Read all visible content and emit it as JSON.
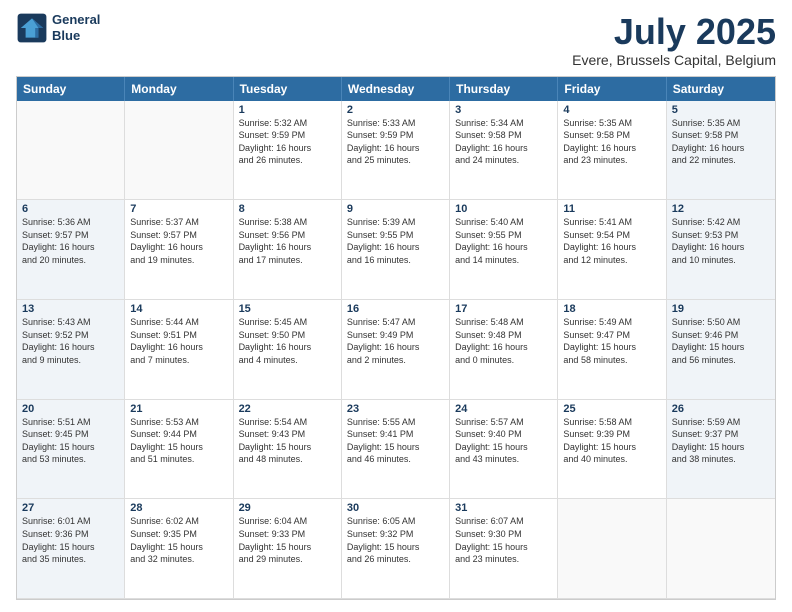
{
  "logo": {
    "line1": "General",
    "line2": "Blue"
  },
  "title": "July 2025",
  "location": "Evere, Brussels Capital, Belgium",
  "dayHeaders": [
    "Sunday",
    "Monday",
    "Tuesday",
    "Wednesday",
    "Thursday",
    "Friday",
    "Saturday"
  ],
  "weeks": [
    [
      {
        "day": "",
        "empty": true,
        "weekend": false,
        "lines": []
      },
      {
        "day": "",
        "empty": true,
        "weekend": false,
        "lines": []
      },
      {
        "day": "1",
        "empty": false,
        "weekend": false,
        "lines": [
          "Sunrise: 5:32 AM",
          "Sunset: 9:59 PM",
          "Daylight: 16 hours",
          "and 26 minutes."
        ]
      },
      {
        "day": "2",
        "empty": false,
        "weekend": false,
        "lines": [
          "Sunrise: 5:33 AM",
          "Sunset: 9:59 PM",
          "Daylight: 16 hours",
          "and 25 minutes."
        ]
      },
      {
        "day": "3",
        "empty": false,
        "weekend": false,
        "lines": [
          "Sunrise: 5:34 AM",
          "Sunset: 9:58 PM",
          "Daylight: 16 hours",
          "and 24 minutes."
        ]
      },
      {
        "day": "4",
        "empty": false,
        "weekend": false,
        "lines": [
          "Sunrise: 5:35 AM",
          "Sunset: 9:58 PM",
          "Daylight: 16 hours",
          "and 23 minutes."
        ]
      },
      {
        "day": "5",
        "empty": false,
        "weekend": true,
        "lines": [
          "Sunrise: 5:35 AM",
          "Sunset: 9:58 PM",
          "Daylight: 16 hours",
          "and 22 minutes."
        ]
      }
    ],
    [
      {
        "day": "6",
        "empty": false,
        "weekend": true,
        "lines": [
          "Sunrise: 5:36 AM",
          "Sunset: 9:57 PM",
          "Daylight: 16 hours",
          "and 20 minutes."
        ]
      },
      {
        "day": "7",
        "empty": false,
        "weekend": false,
        "lines": [
          "Sunrise: 5:37 AM",
          "Sunset: 9:57 PM",
          "Daylight: 16 hours",
          "and 19 minutes."
        ]
      },
      {
        "day": "8",
        "empty": false,
        "weekend": false,
        "lines": [
          "Sunrise: 5:38 AM",
          "Sunset: 9:56 PM",
          "Daylight: 16 hours",
          "and 17 minutes."
        ]
      },
      {
        "day": "9",
        "empty": false,
        "weekend": false,
        "lines": [
          "Sunrise: 5:39 AM",
          "Sunset: 9:55 PM",
          "Daylight: 16 hours",
          "and 16 minutes."
        ]
      },
      {
        "day": "10",
        "empty": false,
        "weekend": false,
        "lines": [
          "Sunrise: 5:40 AM",
          "Sunset: 9:55 PM",
          "Daylight: 16 hours",
          "and 14 minutes."
        ]
      },
      {
        "day": "11",
        "empty": false,
        "weekend": false,
        "lines": [
          "Sunrise: 5:41 AM",
          "Sunset: 9:54 PM",
          "Daylight: 16 hours",
          "and 12 minutes."
        ]
      },
      {
        "day": "12",
        "empty": false,
        "weekend": true,
        "lines": [
          "Sunrise: 5:42 AM",
          "Sunset: 9:53 PM",
          "Daylight: 16 hours",
          "and 10 minutes."
        ]
      }
    ],
    [
      {
        "day": "13",
        "empty": false,
        "weekend": true,
        "lines": [
          "Sunrise: 5:43 AM",
          "Sunset: 9:52 PM",
          "Daylight: 16 hours",
          "and 9 minutes."
        ]
      },
      {
        "day": "14",
        "empty": false,
        "weekend": false,
        "lines": [
          "Sunrise: 5:44 AM",
          "Sunset: 9:51 PM",
          "Daylight: 16 hours",
          "and 7 minutes."
        ]
      },
      {
        "day": "15",
        "empty": false,
        "weekend": false,
        "lines": [
          "Sunrise: 5:45 AM",
          "Sunset: 9:50 PM",
          "Daylight: 16 hours",
          "and 4 minutes."
        ]
      },
      {
        "day": "16",
        "empty": false,
        "weekend": false,
        "lines": [
          "Sunrise: 5:47 AM",
          "Sunset: 9:49 PM",
          "Daylight: 16 hours",
          "and 2 minutes."
        ]
      },
      {
        "day": "17",
        "empty": false,
        "weekend": false,
        "lines": [
          "Sunrise: 5:48 AM",
          "Sunset: 9:48 PM",
          "Daylight: 16 hours",
          "and 0 minutes."
        ]
      },
      {
        "day": "18",
        "empty": false,
        "weekend": false,
        "lines": [
          "Sunrise: 5:49 AM",
          "Sunset: 9:47 PM",
          "Daylight: 15 hours",
          "and 58 minutes."
        ]
      },
      {
        "day": "19",
        "empty": false,
        "weekend": true,
        "lines": [
          "Sunrise: 5:50 AM",
          "Sunset: 9:46 PM",
          "Daylight: 15 hours",
          "and 56 minutes."
        ]
      }
    ],
    [
      {
        "day": "20",
        "empty": false,
        "weekend": true,
        "lines": [
          "Sunrise: 5:51 AM",
          "Sunset: 9:45 PM",
          "Daylight: 15 hours",
          "and 53 minutes."
        ]
      },
      {
        "day": "21",
        "empty": false,
        "weekend": false,
        "lines": [
          "Sunrise: 5:53 AM",
          "Sunset: 9:44 PM",
          "Daylight: 15 hours",
          "and 51 minutes."
        ]
      },
      {
        "day": "22",
        "empty": false,
        "weekend": false,
        "lines": [
          "Sunrise: 5:54 AM",
          "Sunset: 9:43 PM",
          "Daylight: 15 hours",
          "and 48 minutes."
        ]
      },
      {
        "day": "23",
        "empty": false,
        "weekend": false,
        "lines": [
          "Sunrise: 5:55 AM",
          "Sunset: 9:41 PM",
          "Daylight: 15 hours",
          "and 46 minutes."
        ]
      },
      {
        "day": "24",
        "empty": false,
        "weekend": false,
        "lines": [
          "Sunrise: 5:57 AM",
          "Sunset: 9:40 PM",
          "Daylight: 15 hours",
          "and 43 minutes."
        ]
      },
      {
        "day": "25",
        "empty": false,
        "weekend": false,
        "lines": [
          "Sunrise: 5:58 AM",
          "Sunset: 9:39 PM",
          "Daylight: 15 hours",
          "and 40 minutes."
        ]
      },
      {
        "day": "26",
        "empty": false,
        "weekend": true,
        "lines": [
          "Sunrise: 5:59 AM",
          "Sunset: 9:37 PM",
          "Daylight: 15 hours",
          "and 38 minutes."
        ]
      }
    ],
    [
      {
        "day": "27",
        "empty": false,
        "weekend": true,
        "lines": [
          "Sunrise: 6:01 AM",
          "Sunset: 9:36 PM",
          "Daylight: 15 hours",
          "and 35 minutes."
        ]
      },
      {
        "day": "28",
        "empty": false,
        "weekend": false,
        "lines": [
          "Sunrise: 6:02 AM",
          "Sunset: 9:35 PM",
          "Daylight: 15 hours",
          "and 32 minutes."
        ]
      },
      {
        "day": "29",
        "empty": false,
        "weekend": false,
        "lines": [
          "Sunrise: 6:04 AM",
          "Sunset: 9:33 PM",
          "Daylight: 15 hours",
          "and 29 minutes."
        ]
      },
      {
        "day": "30",
        "empty": false,
        "weekend": false,
        "lines": [
          "Sunrise: 6:05 AM",
          "Sunset: 9:32 PM",
          "Daylight: 15 hours",
          "and 26 minutes."
        ]
      },
      {
        "day": "31",
        "empty": false,
        "weekend": false,
        "lines": [
          "Sunrise: 6:07 AM",
          "Sunset: 9:30 PM",
          "Daylight: 15 hours",
          "and 23 minutes."
        ]
      },
      {
        "day": "",
        "empty": true,
        "weekend": false,
        "lines": []
      },
      {
        "day": "",
        "empty": true,
        "weekend": false,
        "lines": []
      }
    ]
  ]
}
